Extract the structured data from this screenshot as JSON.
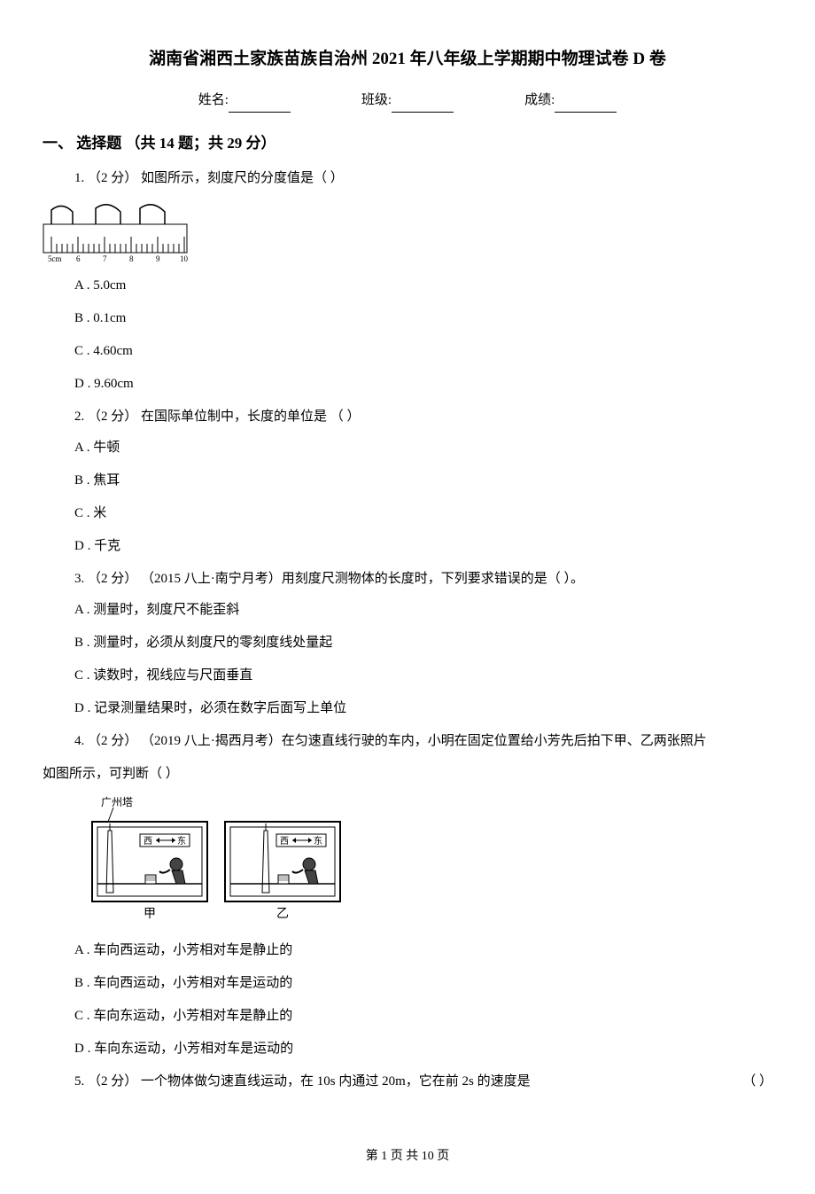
{
  "title": "湖南省湘西土家族苗族自治州 2021 年八年级上学期期中物理试卷 D 卷",
  "form": {
    "name_label": "姓名:",
    "class_label": "班级:",
    "score_label": "成绩:"
  },
  "section": {
    "heading": "一、 选择题 （共 14 题；共 29 分）"
  },
  "q1": {
    "stem": "1.   （2 分）  如图所示，刻度尺的分度值是（      ）",
    "ruler": {
      "ticks": [
        "5cm",
        "6",
        "7",
        "8",
        "9",
        "10"
      ]
    },
    "options": {
      "a": "A .  5.0cm",
      "b": "B .  0.1cm",
      "c": "C .  4.60cm",
      "d": "D .  9.60cm"
    }
  },
  "q2": {
    "stem": "2.   （2 分）  在国际单位制中，长度的单位是      （      ）",
    "options": {
      "a": "A .  牛顿",
      "b": "B .  焦耳",
      "c": "C .  米",
      "d": "D .  千克"
    }
  },
  "q3": {
    "stem": "3.   （2 分）  （2015 八上·南宁月考）用刻度尺测物体的长度时，下列要求错误的是（      ）。",
    "options": {
      "a": "A .  测量时，刻度尺不能歪斜",
      "b": "B .  测量时，必须从刻度尺的零刻度线处量起",
      "c": "C .  读数时，视线应与尺面垂直",
      "d": "D .  记录测量结果时，必须在数字后面写上单位"
    }
  },
  "q4": {
    "stem1": "4.  （2 分）  （2019 八上·揭西月考）在匀速直线行驶的车内，小明在固定位置给小芳先后拍下甲、乙两张照片",
    "stem2": "如图所示，可判断（      ）",
    "fig": {
      "tower_label": "广州塔",
      "west": "西",
      "east": "东",
      "caption_a": "甲",
      "caption_b": "乙"
    },
    "options": {
      "a": "A .  车向西运动，小芳相对车是静止的",
      "b": "B .  车向西运动，小芳相对车是运动的",
      "c": "C .  车向东运动，小芳相对车是静止的",
      "d": "D .  车向东运动，小芳相对车是运动的"
    }
  },
  "q5": {
    "stem": "5.   （2 分）  一个物体做匀速直线运动，在 10s 内通过 20m，它在前 2s 的速度是",
    "paren": "（      ）"
  },
  "footer": "第 1 页 共 10 页"
}
